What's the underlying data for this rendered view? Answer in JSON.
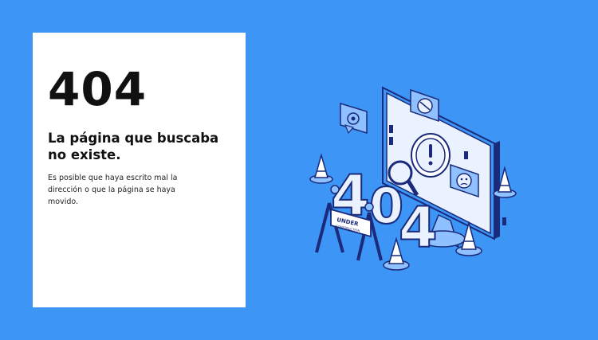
{
  "error": {
    "code": "404",
    "title": "La página que buscaba no existe.",
    "description": "Es posible que haya escrito mal la dirección o que la página se haya movido."
  },
  "illustration": {
    "sign_text_line1": "UNDER",
    "sign_text_line2": "CONSTRUCTION",
    "big_digits": [
      "4",
      "0",
      "4"
    ]
  },
  "colors": {
    "background": "#3d95f6",
    "card": "#ffffff",
    "ink": "#111111",
    "illustration_outline": "#1b2a7a",
    "illustration_fill_light": "#eaf2ff",
    "illustration_fill_mid": "#8fc0ff"
  }
}
